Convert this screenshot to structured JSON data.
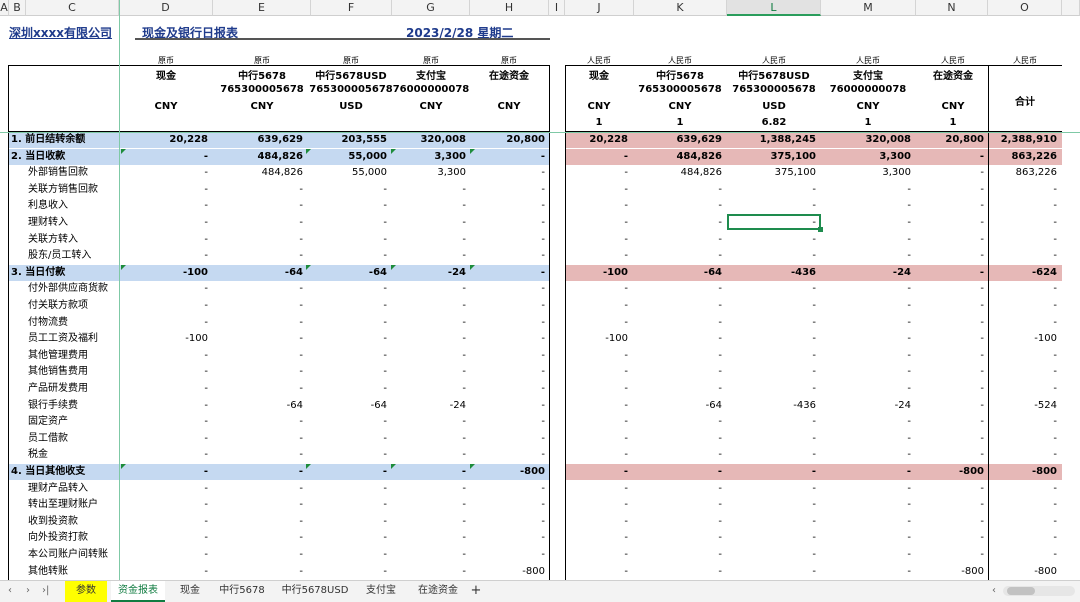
{
  "columns": [
    "A",
    "B",
    "C",
    "D",
    "E",
    "F",
    "G",
    "H",
    "I",
    "J",
    "K",
    "L",
    "M",
    "N",
    "O"
  ],
  "title": {
    "company": "深圳xxxx有限公司",
    "report": "现金及银行日报表",
    "date": "2023/2/28 星期二"
  },
  "hdr": {
    "orig": "原币",
    "rmb": "人民币",
    "total": "合计",
    "names": [
      "现金",
      "中行5678",
      "中行5678USD",
      "支付宝",
      "在途资金"
    ],
    "accts": [
      "",
      "765300005678",
      "765300005678",
      "76000000078",
      ""
    ],
    "curr": [
      "CNY",
      "CNY",
      "USD",
      "CNY",
      "CNY"
    ],
    "rates": [
      "1",
      "1",
      "6.82",
      "1",
      "1"
    ]
  },
  "rows": [
    {
      "t": "s",
      "label": "1. 前日结转余额",
      "o": [
        "20,228",
        "639,629",
        "203,555",
        "320,008",
        "20,800"
      ],
      "c": [
        "20,228",
        "639,629",
        "1,388,245",
        "320,008",
        "20,800"
      ],
      "tot": "2,388,910"
    },
    {
      "t": "s",
      "label": "2. 当日收款",
      "o": [
        "-",
        "484,826",
        "55,000",
        "3,300",
        "-"
      ],
      "c": [
        "-",
        "484,826",
        "375,100",
        "3,300",
        "-"
      ],
      "tot": "863,226"
    },
    {
      "t": "d",
      "label": "外部销售回款",
      "o": [
        "-",
        "484,826",
        "55,000",
        "3,300",
        "-"
      ],
      "c": [
        "-",
        "484,826",
        "375,100",
        "3,300",
        "-"
      ],
      "tot": "863,226"
    },
    {
      "t": "d",
      "label": "关联方销售回款",
      "o": [
        "-",
        "-",
        "-",
        "-",
        "-"
      ],
      "c": [
        "-",
        "-",
        "-",
        "-",
        "-"
      ],
      "tot": "-"
    },
    {
      "t": "d",
      "label": "利息收入",
      "o": [
        "-",
        "-",
        "-",
        "-",
        "-"
      ],
      "c": [
        "-",
        "-",
        "-",
        "-",
        "-"
      ],
      "tot": "-"
    },
    {
      "t": "d",
      "label": "理财转入",
      "o": [
        "-",
        "-",
        "-",
        "-",
        "-"
      ],
      "c": [
        "-",
        "-",
        "-",
        "-",
        "-"
      ],
      "tot": "-"
    },
    {
      "t": "d",
      "label": "关联方转入",
      "o": [
        "-",
        "-",
        "-",
        "-",
        "-"
      ],
      "c": [
        "-",
        "-",
        "-",
        "-",
        "-"
      ],
      "tot": "-"
    },
    {
      "t": "d",
      "label": "股东/员工转入",
      "o": [
        "-",
        "-",
        "-",
        "-",
        "-"
      ],
      "c": [
        "-",
        "-",
        "-",
        "-",
        "-"
      ],
      "tot": "-"
    },
    {
      "t": "s",
      "label": "3. 当日付款",
      "o": [
        "-100",
        "-64",
        "-64",
        "-24",
        "-"
      ],
      "c": [
        "-100",
        "-64",
        "-436",
        "-24",
        "-"
      ],
      "tot": "-624"
    },
    {
      "t": "d",
      "label": "付外部供应商货款",
      "o": [
        "-",
        "-",
        "-",
        "-",
        "-"
      ],
      "c": [
        "-",
        "-",
        "-",
        "-",
        "-"
      ],
      "tot": "-"
    },
    {
      "t": "d",
      "label": "付关联方款项",
      "o": [
        "-",
        "-",
        "-",
        "-",
        "-"
      ],
      "c": [
        "-",
        "-",
        "-",
        "-",
        "-"
      ],
      "tot": "-"
    },
    {
      "t": "d",
      "label": "付物流费",
      "o": [
        "-",
        "-",
        "-",
        "-",
        "-"
      ],
      "c": [
        "-",
        "-",
        "-",
        "-",
        "-"
      ],
      "tot": "-"
    },
    {
      "t": "d",
      "label": "员工工资及福利",
      "o": [
        "-100",
        "-",
        "-",
        "-",
        "-"
      ],
      "c": [
        "-100",
        "-",
        "-",
        "-",
        "-"
      ],
      "tot": "-100"
    },
    {
      "t": "d",
      "label": "其他管理费用",
      "o": [
        "-",
        "-",
        "-",
        "-",
        "-"
      ],
      "c": [
        "-",
        "-",
        "-",
        "-",
        "-"
      ],
      "tot": "-"
    },
    {
      "t": "d",
      "label": "其他销售费用",
      "o": [
        "-",
        "-",
        "-",
        "-",
        "-"
      ],
      "c": [
        "-",
        "-",
        "-",
        "-",
        "-"
      ],
      "tot": "-"
    },
    {
      "t": "d",
      "label": "产品研发费用",
      "o": [
        "-",
        "-",
        "-",
        "-",
        "-"
      ],
      "c": [
        "-",
        "-",
        "-",
        "-",
        "-"
      ],
      "tot": "-"
    },
    {
      "t": "d",
      "label": "银行手续费",
      "o": [
        "-",
        "-64",
        "-64",
        "-24",
        "-"
      ],
      "c": [
        "-",
        "-64",
        "-436",
        "-24",
        "-"
      ],
      "tot": "-524"
    },
    {
      "t": "d",
      "label": "固定资产",
      "o": [
        "-",
        "-",
        "-",
        "-",
        "-"
      ],
      "c": [
        "-",
        "-",
        "-",
        "-",
        "-"
      ],
      "tot": "-"
    },
    {
      "t": "d",
      "label": "员工借款",
      "o": [
        "-",
        "-",
        "-",
        "-",
        "-"
      ],
      "c": [
        "-",
        "-",
        "-",
        "-",
        "-"
      ],
      "tot": "-"
    },
    {
      "t": "d",
      "label": "税金",
      "o": [
        "-",
        "-",
        "-",
        "-",
        "-"
      ],
      "c": [
        "-",
        "-",
        "-",
        "-",
        "-"
      ],
      "tot": "-"
    },
    {
      "t": "s",
      "label": "4. 当日其他收支",
      "o": [
        "-",
        "-",
        "-",
        "-",
        "-800"
      ],
      "c": [
        "-",
        "-",
        "-",
        "-",
        "-800"
      ],
      "tot": "-800"
    },
    {
      "t": "d",
      "label": "理财产品转入",
      "o": [
        "-",
        "-",
        "-",
        "-",
        "-"
      ],
      "c": [
        "-",
        "-",
        "-",
        "-",
        "-"
      ],
      "tot": "-"
    },
    {
      "t": "d",
      "label": "转出至理财账户",
      "o": [
        "-",
        "-",
        "-",
        "-",
        "-"
      ],
      "c": [
        "-",
        "-",
        "-",
        "-",
        "-"
      ],
      "tot": "-"
    },
    {
      "t": "d",
      "label": "收到投资款",
      "o": [
        "-",
        "-",
        "-",
        "-",
        "-"
      ],
      "c": [
        "-",
        "-",
        "-",
        "-",
        "-"
      ],
      "tot": "-"
    },
    {
      "t": "d",
      "label": "向外投资打款",
      "o": [
        "-",
        "-",
        "-",
        "-",
        "-"
      ],
      "c": [
        "-",
        "-",
        "-",
        "-",
        "-"
      ],
      "tot": "-"
    },
    {
      "t": "d",
      "label": "本公司账户间转账",
      "o": [
        "-",
        "-",
        "-",
        "-",
        "-"
      ],
      "c": [
        "-",
        "-",
        "-",
        "-",
        "-"
      ],
      "tot": "-"
    },
    {
      "t": "d",
      "label": "其他转账",
      "o": [
        "-",
        "-",
        "-",
        "-",
        "-800"
      ],
      "c": [
        "-",
        "-",
        "-",
        "-",
        "-800"
      ],
      "tot": "-800"
    }
  ],
  "tabs": [
    "参数",
    "资金报表",
    "现金",
    "中行5678",
    "中行5678USD",
    "支付宝",
    "在途资金"
  ],
  "tab_add": "+",
  "nav": [
    "‹",
    "›",
    "›|"
  ],
  "scroll_left": "‹"
}
